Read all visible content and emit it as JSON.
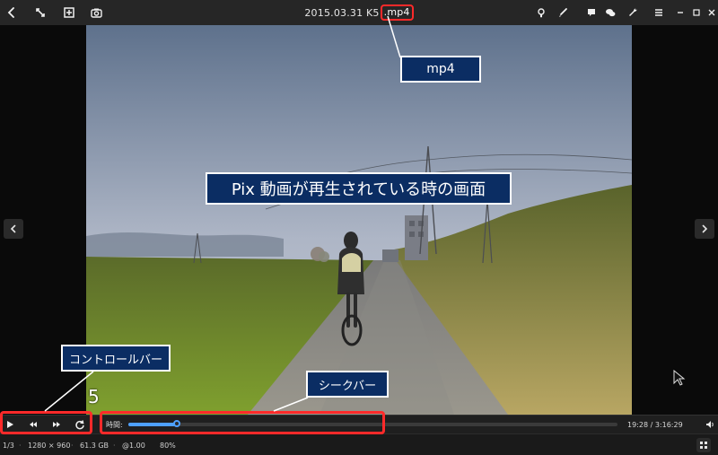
{
  "window": {
    "title_prefix": "2015.03.31 K5",
    "title_ext": ".mp4"
  },
  "toolbar": {
    "left_icons": [
      "back-icon",
      "fullscreen-expand-icon",
      "add-box-icon",
      "camera-icon"
    ],
    "right_icons": [
      "lightbulb-icon",
      "brush-icon",
      "comment-icon",
      "speech-bubbles-icon",
      "wrench-icon",
      "menu-icon",
      "minimize-icon",
      "maximize-icon",
      "close-icon"
    ]
  },
  "annotations": {
    "mp4_label": "mp4",
    "main_label": "Pix 動画が再生されている時の画面",
    "controlbar_label": "コントロールバー",
    "seekbar_label": "シークバー",
    "number_label": "5"
  },
  "controls": {
    "time_label": "時間:",
    "time_readout": "19:28 / 3:16:29",
    "progress_fraction": 0.099
  },
  "status": {
    "index": "1/3",
    "resolution": "1280 × 960",
    "size": "61.3 GB",
    "speed": "@1.00",
    "zoom": "80%"
  },
  "colors": {
    "accent": "#4ea0ff",
    "annotation_red": "#ff2a2a",
    "callout_blue": "#0b2d63"
  }
}
